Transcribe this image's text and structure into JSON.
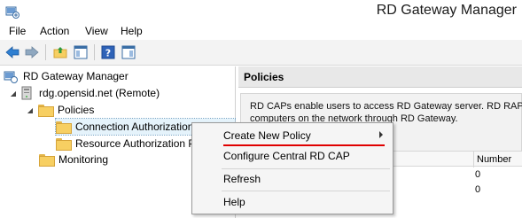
{
  "window": {
    "title": "RD Gateway Manager"
  },
  "menubar": {
    "items": [
      "File",
      "Action",
      "View",
      "Help"
    ]
  },
  "tree": {
    "root": "RD Gateway Manager",
    "server": "rdg.opensid.net (Remote)",
    "policies": "Policies",
    "cap": "Connection Authorization Polici",
    "rap": "Resource Authorization P",
    "monitoring": "Monitoring"
  },
  "right": {
    "header": "Policies",
    "description_line1": "RD CAPs enable users to access RD Gateway server. RD RAPs",
    "description_line2": "computers on the network through RD Gateway.",
    "table": {
      "col_number": "Number",
      "rows": [
        "0",
        "0"
      ]
    }
  },
  "context_menu": {
    "items": [
      "Create New Policy",
      "Configure Central RD CAP",
      "Refresh",
      "Help"
    ],
    "highlight_color": "#e00000"
  }
}
